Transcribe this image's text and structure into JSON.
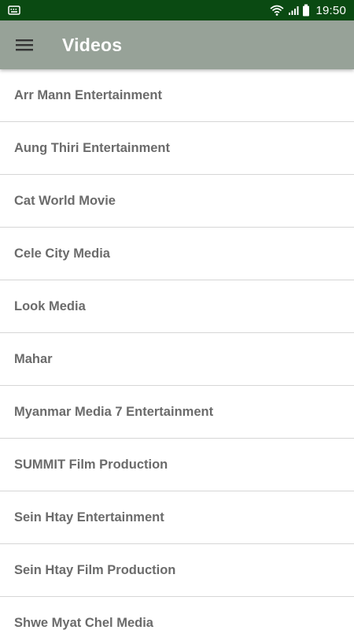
{
  "status_bar": {
    "time": "19:50",
    "icons": [
      "notification-keyboard-icon",
      "wifi-icon",
      "signal-icon",
      "battery-icon"
    ],
    "background": "#0a4a12"
  },
  "app_bar": {
    "title": "Videos",
    "menu_icon": "hamburger-menu-icon",
    "background": "#97a298"
  },
  "list": {
    "items": [
      {
        "label": "Arr Mann Entertainment"
      },
      {
        "label": "Aung Thiri Entertainment"
      },
      {
        "label": "Cat World Movie"
      },
      {
        "label": "Cele City Media"
      },
      {
        "label": "Look Media"
      },
      {
        "label": "Mahar"
      },
      {
        "label": "Myanmar Media 7 Entertainment"
      },
      {
        "label": "SUMMIT Film Production"
      },
      {
        "label": "Sein Htay Entertainment"
      },
      {
        "label": "Sein Htay Film Production"
      },
      {
        "label": "Shwe Myat Chel Media"
      }
    ]
  }
}
